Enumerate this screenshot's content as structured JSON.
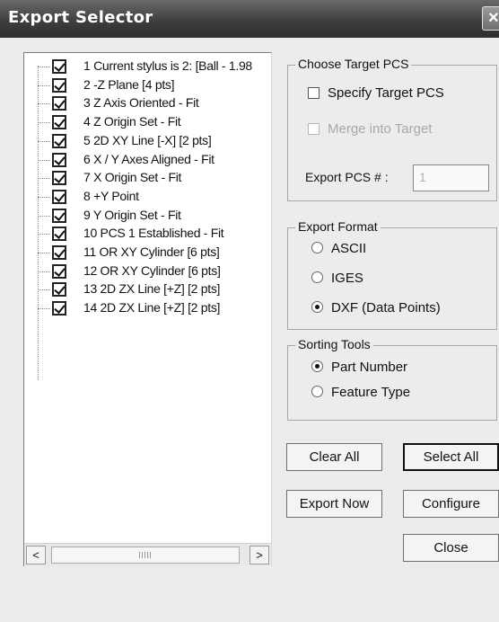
{
  "window": {
    "title": "Export Selector",
    "close_glyph": "×"
  },
  "features": {
    "items": [
      {
        "label": "1 Current stylus is 2: [Ball - 1.98",
        "checked": true
      },
      {
        "label": "2 -Z Plane [4 pts]",
        "checked": true
      },
      {
        "label": "3 Z Axis Oriented - Fit",
        "checked": true
      },
      {
        "label": "4 Z Origin Set - Fit",
        "checked": true
      },
      {
        "label": "5 2D XY Line [-X] [2 pts]",
        "checked": true
      },
      {
        "label": "6 X / Y Axes Aligned - Fit",
        "checked": true
      },
      {
        "label": "7 X Origin Set - Fit",
        "checked": true
      },
      {
        "label": "8 +Y Point",
        "checked": true
      },
      {
        "label": "9 Y Origin Set - Fit",
        "checked": true
      },
      {
        "label": "10 PCS 1 Established - Fit",
        "checked": true
      },
      {
        "label": "11 OR XY Cylinder [6 pts]",
        "checked": true
      },
      {
        "label": "12 OR XY Cylinder [6 pts]",
        "checked": true
      },
      {
        "label": "13 2D ZX Line [+Z] [2 pts]",
        "checked": true
      },
      {
        "label": "14 2D ZX Line [+Z] [2 pts]",
        "checked": true
      }
    ],
    "scroll_left": "<",
    "scroll_right": ">"
  },
  "target_pcs": {
    "title": "Choose Target PCS",
    "specify_label": "Specify Target PCS",
    "specify_checked": false,
    "merge_label": "Merge into Target",
    "merge_enabled": false,
    "export_pcs_label": "Export PCS # :",
    "export_pcs_value": "1"
  },
  "export_format": {
    "title": "Export Format",
    "options": [
      {
        "label": "ASCII",
        "selected": false
      },
      {
        "label": "IGES",
        "selected": false
      },
      {
        "label": "DXF (Data Points)",
        "selected": true
      }
    ]
  },
  "sorting_tools": {
    "title": "Sorting Tools",
    "options": [
      {
        "label": "Part Number",
        "selected": true
      },
      {
        "label": "Feature Type",
        "selected": false
      }
    ]
  },
  "buttons": {
    "clear_all": "Clear All",
    "select_all": "Select All",
    "export_now": "Export Now",
    "configure": "Configure",
    "close": "Close"
  }
}
